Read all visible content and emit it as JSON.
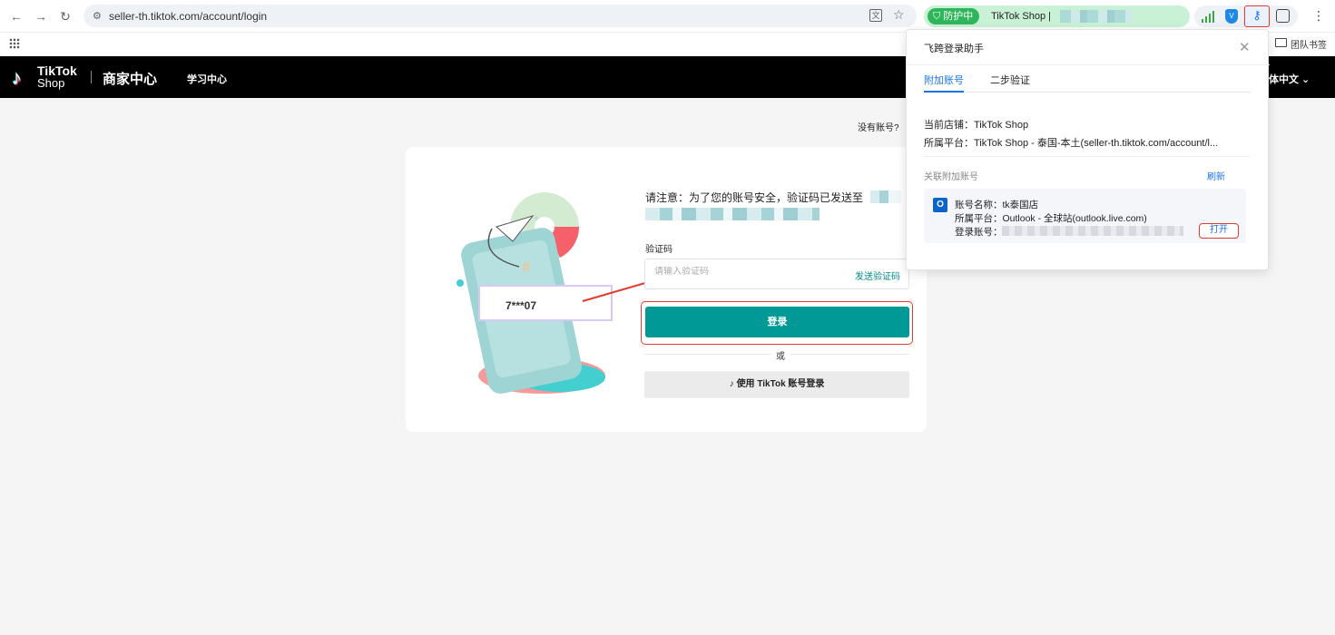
{
  "browser": {
    "url": "seller-th.tiktok.com/account/login",
    "ext_badge": "防护中",
    "ext_shop": "TikTok Shop | ",
    "bookmark_folder": "团队书签"
  },
  "header": {
    "logo_line1": "TikTok",
    "logo_line2": "Shop",
    "merchant_center": "商家中心",
    "learning_center": "学习中心",
    "language": "体中文 ⌄"
  },
  "page": {
    "no_account": "没有账号?",
    "notice": "请注意：为了您的账号安全，验证码已发送至",
    "code_label": "验证码",
    "code_placeholder": "请输入验证码",
    "send_code": "发送验证码",
    "login": "登录",
    "or": "或",
    "tiktok_login": "使用 TikTok 账号登录",
    "illus_code": "7***07"
  },
  "popup": {
    "title": "飞跨登录助手",
    "tabs": [
      "附加账号",
      "二步验证"
    ],
    "current_store": "当前店铺：TikTok Shop",
    "platform": "所属平台：TikTok Shop - 泰国-本土(seller-th.tiktok.com/account/l...",
    "linked_label": "关联附加账号",
    "refresh": "刷新",
    "account_name": "账号名称：tk泰国店",
    "account_platform": "所属平台：Outlook - 全球站(outlook.live.com)",
    "account_login": "登录账号：",
    "open": "打开"
  },
  "colors": {
    "accent": "#009995",
    "highlight": "#e23b2e",
    "link": "#1a73e8"
  }
}
